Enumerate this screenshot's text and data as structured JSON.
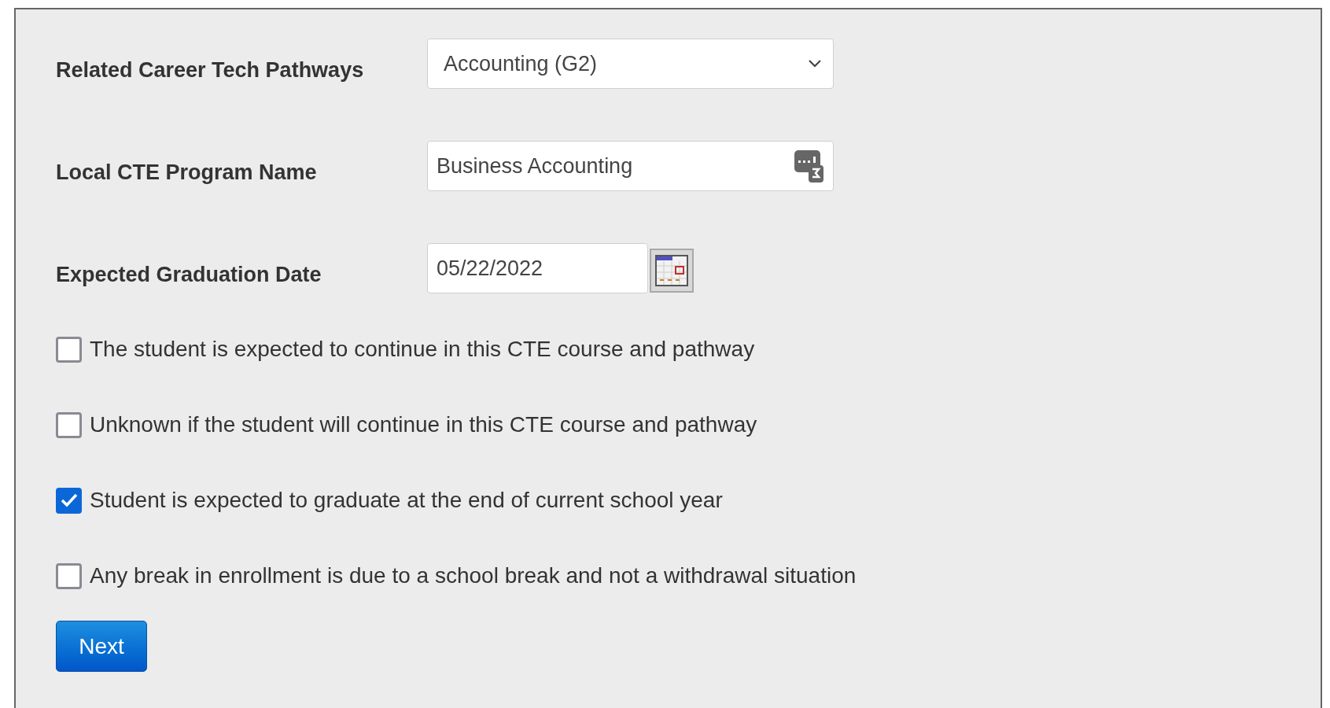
{
  "fields": [
    {
      "kind": "select",
      "label": "Related Career Tech Pathways",
      "value": "Accounting (G2)"
    },
    {
      "kind": "text",
      "label": "Local CTE Program Name",
      "value": "Business Accounting"
    },
    {
      "kind": "date",
      "label": "Expected Graduation Date",
      "value": "05/22/2022"
    }
  ],
  "options": [
    {
      "label": "The student is expected to continue in this CTE course and pathway",
      "checked": false
    },
    {
      "label": "Unknown if the student will continue in this CTE course and pathway",
      "checked": false
    },
    {
      "label": "Student is expected to graduate at the end of current school year",
      "checked": true
    },
    {
      "label": "Any break in enrollment is due to a school break and not a withdrawal situation",
      "checked": false
    }
  ],
  "button": "Next"
}
